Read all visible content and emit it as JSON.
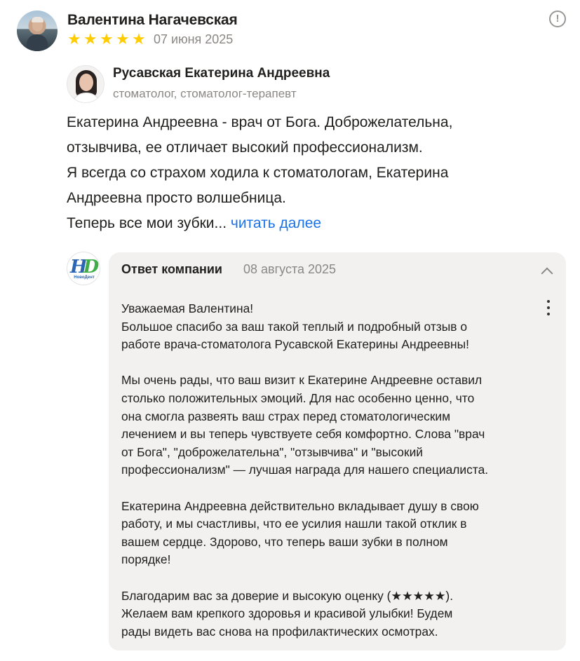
{
  "review": {
    "author": "Валентина Нагачевская",
    "rating": 5,
    "stars": [
      "★",
      "★",
      "★",
      "★",
      "★"
    ],
    "date": "07 июня 2025",
    "report_icon": "exclamation-circle-icon",
    "report_glyph": "!",
    "doctor": {
      "name": "Русавская Екатерина Андреевна",
      "specialty": "стоматолог, стоматолог-терапевт"
    },
    "text_lines": [
      "Екатерина Андреевна - врач от Бога. Доброжелательна,",
      "отзывчива, ее отличает высокий профессионализм.",
      "Я всегда со страхом ходила к стоматологам, Екатерина",
      "Андреевна просто волшебница.",
      "Теперь все мои зубки..."
    ],
    "read_more": "читать далее"
  },
  "company_reply": {
    "logo_letters": "НD",
    "logo_text": "НовоДент",
    "title": "Ответ компании",
    "date": "08 августа 2025",
    "paragraphs": [
      "Уважаемая Валентина!\nБольшое спасибо за ваш такой теплый и подробный отзыв о\nработе врача-стоматолога Русавской Екатерины Андреевны!",
      "Мы очень рады, что ваш визит к Екатерине Андреевне оставил\nстолько положительных эмоций. Для нас особенно ценно, что\nона смогла развеять ваш страх перед стоматологическим\nлечением и вы теперь чувствуете себя комфортно. Слова \"врач\nот Бога\", \"доброжелательна\", \"отзывчива\" и \"высокий\nпрофессионализм\" — лучшая награда для нашего специалиста.",
      "Екатерина Андреевна действительно вкладывает душу в свою\nработу, и мы счастливы, что ее усилия нашли такой отклик в\nвашем сердце. Здорово, что теперь ваши зубки в полном\nпорядке!",
      "Благодарим вас за доверие и высокую оценку (★★★★★).\nЖелаем вам крепкого здоровья и красивой улыбки! Будем\nрады видеть вас снова на профилактических осмотрах."
    ]
  },
  "colors": {
    "star": "#ffcc00",
    "link": "#1a73e8",
    "muted": "#8a8784",
    "reply_bg": "#f2f1f0"
  }
}
